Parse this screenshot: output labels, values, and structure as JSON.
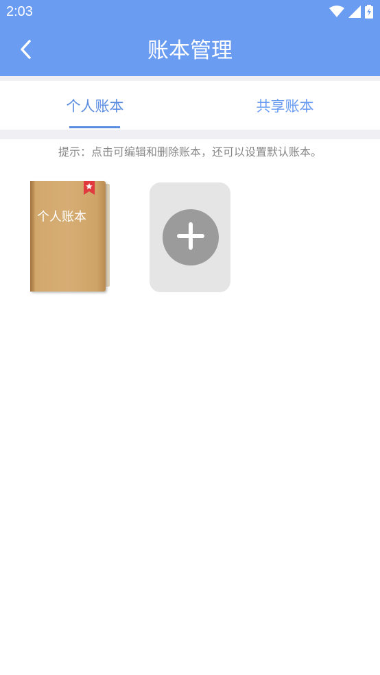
{
  "status_bar": {
    "time": "2:03",
    "icons": [
      "wifi-icon",
      "cell-signal-icon",
      "battery-charging-icon"
    ]
  },
  "app_bar": {
    "title": "账本管理",
    "back_icon": "back-arrow-icon"
  },
  "tabs": [
    {
      "label": "个人账本",
      "active": true
    },
    {
      "label": "共享账本",
      "active": false
    }
  ],
  "hint": "提示：点击可编辑和删除账本，还可以设置默认账本。",
  "books": [
    {
      "name": "个人账本",
      "is_default": true
    }
  ],
  "add_book_icon": "plus-icon",
  "colors": {
    "primary": "#6a9cf2",
    "tab_text": "#5a8de0",
    "hint_text": "#888888",
    "book": "#d6ad74",
    "default_marker": "#e03a3e",
    "add_card_bg": "#e5e5e5",
    "add_circle": "#9b9b9b"
  }
}
